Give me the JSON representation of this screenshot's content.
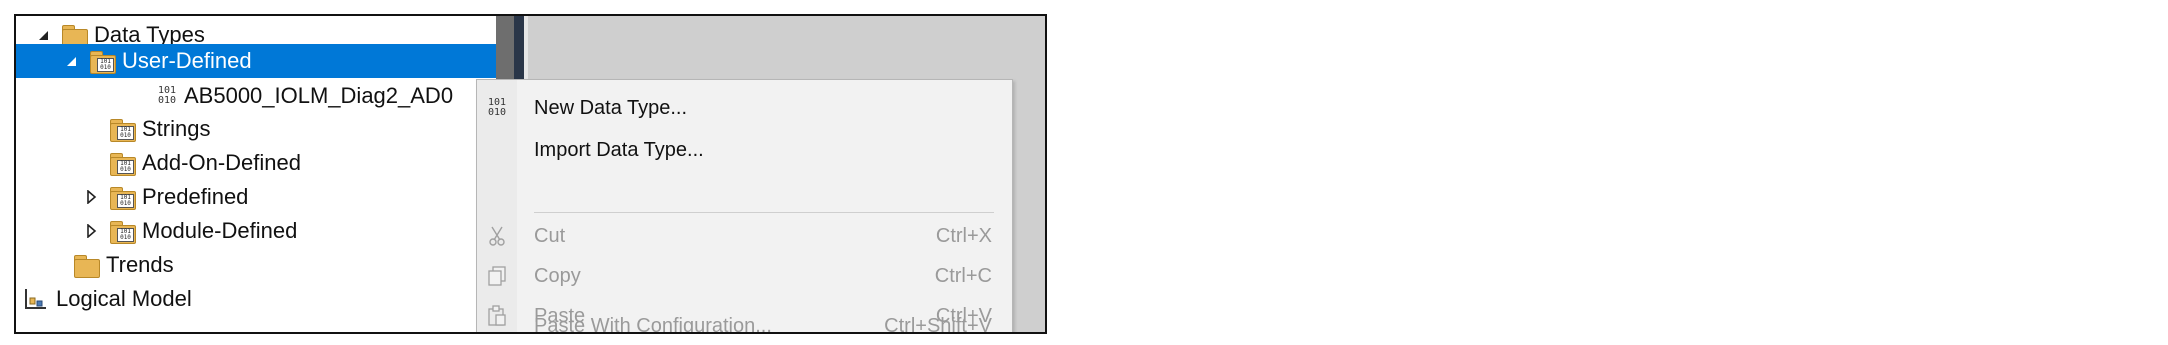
{
  "tree": {
    "items": [
      {
        "label": "Data Types",
        "icon": "folder-icon",
        "expander": "expanded"
      },
      {
        "label": "User-Defined",
        "icon": "data-type-folder-icon",
        "expander": "expanded",
        "selected": true
      },
      {
        "label": "AB5000_IOLM_Diag2_AD0",
        "icon": "binary-icon"
      },
      {
        "label": "Strings",
        "icon": "data-type-folder-icon"
      },
      {
        "label": "Add-On-Defined",
        "icon": "data-type-folder-icon"
      },
      {
        "label": "Predefined",
        "icon": "data-type-folder-icon",
        "expander": "collapsed"
      },
      {
        "label": "Module-Defined",
        "icon": "data-type-folder-icon",
        "expander": "collapsed"
      },
      {
        "label": "Trends",
        "icon": "folder-icon"
      },
      {
        "label": "Logical Model",
        "icon": "logical-model-icon"
      }
    ]
  },
  "context_menu": {
    "items": [
      {
        "label": "New Data Type...",
        "icon": "binary-icon",
        "enabled": true
      },
      {
        "label": "Import Data Type...",
        "enabled": true
      },
      {
        "label": "Cut",
        "shortcut": "Ctrl+X",
        "icon": "scissors-icon",
        "enabled": false
      },
      {
        "label": "Copy",
        "shortcut": "Ctrl+C",
        "icon": "copy-icon",
        "enabled": false
      },
      {
        "label": "Paste",
        "shortcut": "Ctrl+V",
        "icon": "paste-icon",
        "enabled": false
      },
      {
        "label": "Paste With Configuration...",
        "shortcut": "Ctrl+Shift+V",
        "enabled": false
      }
    ]
  },
  "colors": {
    "selection": "#0078d7",
    "folder": "#e8b655",
    "disabled_text": "#9a9a9a"
  }
}
